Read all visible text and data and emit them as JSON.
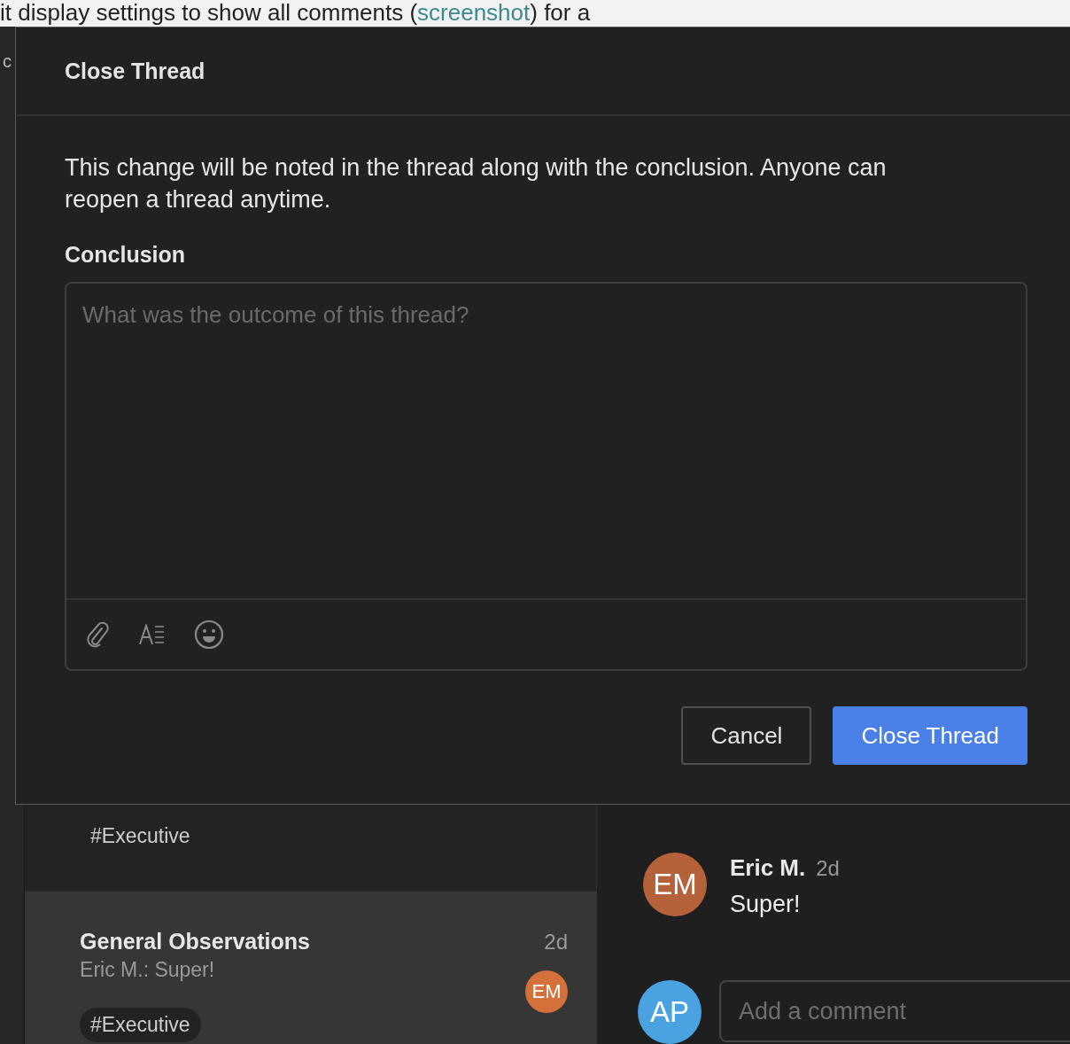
{
  "page_text": {
    "before": "it display settings to show all comments (",
    "link": "screenshot",
    "after": ") for a"
  },
  "sidebar": {
    "label": "c"
  },
  "threads": [
    {
      "tags": [
        "#Executive"
      ],
      "selected": false
    },
    {
      "title": "General Observations",
      "time": "2d",
      "preview": "Eric M.: Super!",
      "avatar": {
        "initials": "EM",
        "color": "#d4703a"
      },
      "tags": [
        "#Executive"
      ],
      "selected": true
    }
  ],
  "comments": [
    {
      "author": "Eric M.",
      "time": "2d",
      "text": "Super!",
      "avatar": {
        "initials": "EM",
        "color": "#b5623a"
      }
    }
  ],
  "composer": {
    "avatar": {
      "initials": "AP",
      "color": "#4aa3e0"
    },
    "placeholder": "Add a comment"
  },
  "dialog": {
    "title": "Close Thread",
    "message": "This change will be noted in the thread along with the conclusion. Anyone can reopen a thread anytime.",
    "field_label": "Conclusion",
    "placeholder": "What was the outcome of this thread?",
    "buttons": [
      {
        "label": "Cancel",
        "kind": "secondary"
      },
      {
        "label": "Close Thread",
        "kind": "primary"
      }
    ]
  }
}
